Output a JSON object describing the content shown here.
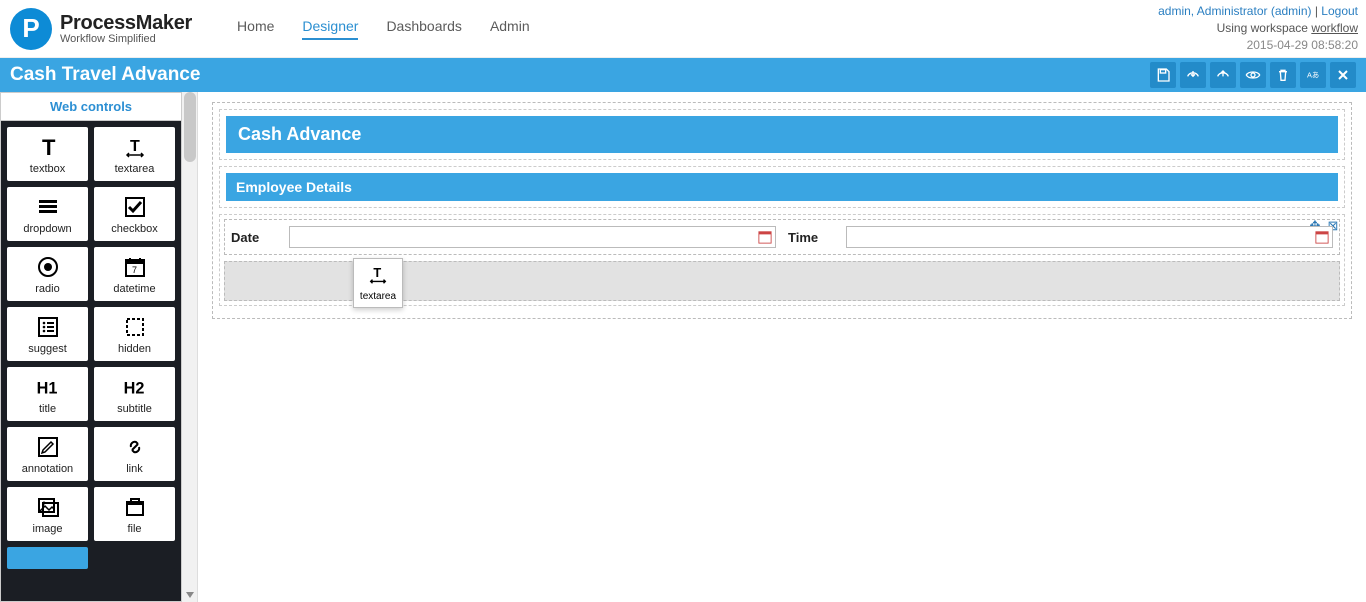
{
  "brand": {
    "name": "ProcessMaker",
    "tag": "Workflow Simplified"
  },
  "nav": {
    "items": [
      "Home",
      "Designer",
      "Dashboards",
      "Admin"
    ],
    "active": 1
  },
  "user": {
    "line": "admin, Administrator (admin)",
    "logout": "Logout",
    "workspace_prefix": "Using workspace ",
    "workspace": "workflow",
    "timestamp": "2015-04-29 08:58:20"
  },
  "page_title": "Cash Travel Advance",
  "toolbar_icons": [
    "save",
    "import",
    "export",
    "preview",
    "delete",
    "language",
    "close"
  ],
  "sidebar": {
    "tab": "Web controls",
    "controls": [
      {
        "id": "textbox",
        "label": "textbox"
      },
      {
        "id": "textarea",
        "label": "textarea"
      },
      {
        "id": "dropdown",
        "label": "dropdown"
      },
      {
        "id": "checkbox",
        "label": "checkbox"
      },
      {
        "id": "radio",
        "label": "radio"
      },
      {
        "id": "datetime",
        "label": "datetime"
      },
      {
        "id": "suggest",
        "label": "suggest"
      },
      {
        "id": "hidden",
        "label": "hidden"
      },
      {
        "id": "title",
        "label": "title"
      },
      {
        "id": "subtitle",
        "label": "subtitle"
      },
      {
        "id": "annotation",
        "label": "annotation"
      },
      {
        "id": "link",
        "label": "link"
      },
      {
        "id": "image",
        "label": "image"
      },
      {
        "id": "file",
        "label": "file"
      }
    ]
  },
  "form": {
    "title_bar": "Cash Advance",
    "subtitle_bar": "Employee Details",
    "date_label": "Date",
    "time_label": "Time",
    "drag_item": "textarea"
  }
}
